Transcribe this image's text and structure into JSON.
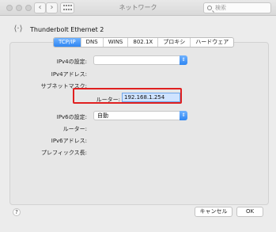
{
  "window": {
    "title": "ネットワーク",
    "search_placeholder": "検索"
  },
  "device": {
    "name": "Thunderbolt Ethernet 2"
  },
  "tabs": [
    {
      "label": "TCP/IP"
    },
    {
      "label": "DNS"
    },
    {
      "label": "WINS"
    },
    {
      "label": "802.1X"
    },
    {
      "label": "プロキシ"
    },
    {
      "label": "ハードウェア"
    }
  ],
  "fields": {
    "ipv4_config_label": "IPv4の設定:",
    "ipv4_address_label": "IPv4アドレス:",
    "subnet_mask_label": "サブネットマスク:",
    "router_label": "ルーター:",
    "router_value": "192.168.1.254",
    "ipv6_config_label": "IPv6の設定:",
    "ipv6_config_value": "自動",
    "router6_label": "ルーター:",
    "ipv6_address_label": "IPv6アドレス:",
    "prefix_length_label": "プレフィックス長:"
  },
  "buttons": {
    "help": "?",
    "cancel": "キャンセル",
    "ok": "OK"
  }
}
